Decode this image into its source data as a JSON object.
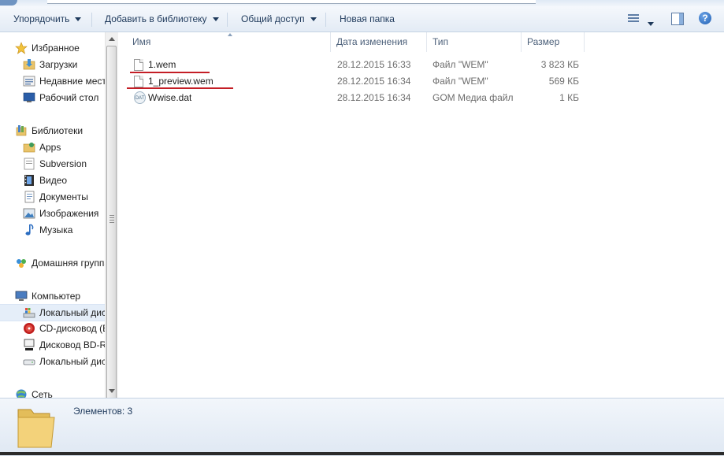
{
  "toolbar": {
    "organize": "Упорядочить",
    "add_to_library": "Добавить в библиотеку",
    "share": "Общий доступ",
    "new_folder": "Новая папка",
    "help_glyph": "?"
  },
  "sidebar": {
    "items": [
      {
        "label": "Избранное",
        "icon": "star-icon"
      },
      {
        "label": "Загрузки",
        "icon": "downloads-folder-icon"
      },
      {
        "label": "Недавние места",
        "icon": "recent-places-icon"
      },
      {
        "label": "Рабочий стол",
        "icon": "desktop-icon"
      },
      {
        "label": "Библиотеки",
        "icon": "libraries-icon"
      },
      {
        "label": "Apps",
        "icon": "library-folder-icon"
      },
      {
        "label": "Subversion",
        "icon": "library-folder-icon"
      },
      {
        "label": "Видео",
        "icon": "video-icon"
      },
      {
        "label": "Документы",
        "icon": "documents-icon"
      },
      {
        "label": "Изображения",
        "icon": "pictures-icon"
      },
      {
        "label": "Музыка",
        "icon": "music-icon"
      },
      {
        "label": "Домашняя группа",
        "icon": "homegroup-icon"
      },
      {
        "label": "Компьютер",
        "icon": "computer-icon"
      },
      {
        "label": "Локальный диск (C:)",
        "icon": "local-disk-icon"
      },
      {
        "label": "CD-дисковод (E:)",
        "icon": "cd-drive-icon"
      },
      {
        "label": "Дисковод BD-ROM",
        "icon": "bd-drive-icon"
      },
      {
        "label": "Локальный диск",
        "icon": "drive-icon"
      },
      {
        "label": "Сеть",
        "icon": "network-icon"
      }
    ]
  },
  "columns": {
    "name": "Имя",
    "date": "Дата изменения",
    "type": "Тип",
    "size": "Размер"
  },
  "files": [
    {
      "name": "1.wem",
      "date": "28.12.2015 16:33",
      "type": "Файл \"WEM\"",
      "size": "3 823 КБ",
      "icon": "file-icon"
    },
    {
      "name": "1_preview.wem",
      "date": "28.12.2015 16:34",
      "type": "Файл \"WEM\"",
      "size": "569 КБ",
      "icon": "file-icon"
    },
    {
      "name": "Wwise.dat",
      "date": "28.12.2015 16:34",
      "type": "GOM Медиа файл (.dat)",
      "size": "1 КБ",
      "icon": "dat-file-icon"
    }
  ],
  "dat_icon_text": "DAT",
  "status": {
    "count": "Элементов: 3"
  },
  "colors": {
    "annotation": "#c41e26",
    "toolbar_text": "#1e395b",
    "selection": "#e5eef9"
  }
}
